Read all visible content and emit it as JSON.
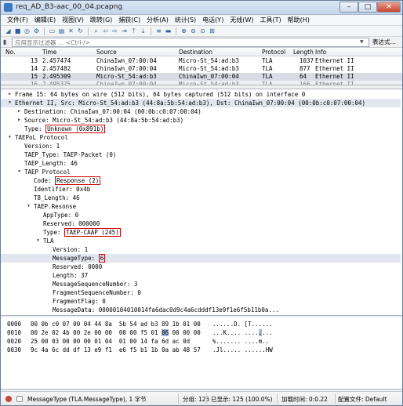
{
  "window": {
    "title": "req_AD_B3-aac_00_04.pcapng",
    "min": "–",
    "max": "□",
    "close": "✕"
  },
  "menu": [
    "文件(F)",
    "编辑(E)",
    "视图(V)",
    "跳转(G)",
    "捕获(C)",
    "分析(A)",
    "统计(S)",
    "电话(Y)",
    "无线(W)",
    "工具(T)",
    "帮助(H)"
  ],
  "toolbar": {
    "icons": [
      {
        "name": "start-capture-icon",
        "glyph": "◢"
      },
      {
        "name": "stop-capture-icon",
        "glyph": "■"
      },
      {
        "name": "restart-capture-icon",
        "glyph": "◎"
      },
      {
        "name": "capture-options-icon",
        "glyph": "⚙"
      },
      {
        "name": "sep"
      },
      {
        "name": "open-file-icon",
        "glyph": "▭"
      },
      {
        "name": "save-file-icon",
        "glyph": "▤"
      },
      {
        "name": "close-file-icon",
        "glyph": "✕"
      },
      {
        "name": "reload-icon",
        "glyph": "↻"
      },
      {
        "name": "sep"
      },
      {
        "name": "find-packet-icon",
        "glyph": "⌕"
      },
      {
        "name": "go-back-icon",
        "glyph": "⇦"
      },
      {
        "name": "go-forward-icon",
        "glyph": "⇨"
      },
      {
        "name": "go-to-packet-icon",
        "glyph": "⇥"
      },
      {
        "name": "first-packet-icon",
        "glyph": "⤒"
      },
      {
        "name": "last-packet-icon",
        "glyph": "⤓"
      },
      {
        "name": "sep"
      },
      {
        "name": "autoscroll-icon",
        "glyph": "≡"
      },
      {
        "name": "colorize-icon",
        "glyph": "▬"
      },
      {
        "name": "sep"
      },
      {
        "name": "zoom-in-icon",
        "glyph": "⊕"
      },
      {
        "name": "zoom-out-icon",
        "glyph": "⊖"
      },
      {
        "name": "zoom-reset-icon",
        "glyph": "⊙"
      },
      {
        "name": "resize-columns-icon",
        "glyph": "⊞"
      }
    ]
  },
  "filter": {
    "placeholder": "应用显示过滤器 … <Ctrl-/>",
    "expression_label": "表达式…",
    "plus": "+"
  },
  "packet_list": {
    "columns": [
      "No.",
      "Time",
      "Source",
      "Destination",
      "Protocol",
      "Length",
      "Info"
    ],
    "rows": [
      {
        "no": "13",
        "time": "2.457474",
        "src": "ChinaIwn_07:00:04",
        "dst": "Micro-St_54:ad:b3",
        "proto": "TLA",
        "len": "1037",
        "info": "Ethernet II",
        "style": "normal"
      },
      {
        "no": "14",
        "time": "2.457482",
        "src": "ChinaIwn_07:00:04",
        "dst": "Micro-St_54:ad:b3",
        "proto": "TLA",
        "len": "877",
        "info": "Ethernet II",
        "style": "normal"
      },
      {
        "no": "15",
        "time": "2.495309",
        "src": "Micro-St_54:ad:b3",
        "dst": "ChinaIwn_07:00:04",
        "proto": "TLA",
        "len": "64",
        "info": "Ethernet II",
        "style": "selected"
      },
      {
        "no": "16",
        "time": "2.495375",
        "src": "ChinaIwn_07:00:04",
        "dst": "Micro-St_54:ad:b3",
        "proto": "TLA",
        "len": "166",
        "info": "Ethernet II",
        "style": "dim"
      }
    ]
  },
  "details": [
    {
      "text": "Frame 15: 64 bytes on wire (512 bits), 64 bytes captured (512 bits) on interface 0",
      "indent": 0,
      "arrow": "▶"
    },
    {
      "text": "Ethernet II, Src: Micro-St_54:ad:b3 (44:8a:5b:54:ad:b3), Dst: ChinaIwn_07:00:04 (00:0b:c0:07:00:04)",
      "indent": 0,
      "arrow": "▼",
      "selected": true
    },
    {
      "text": "Destination: ChinaIwn_07:00:04 (00:0b:c0:07:00:04)",
      "indent": 1,
      "arrow": "▶"
    },
    {
      "text": "Source: Micro-St_54:ad:b3 (44:8a:5b:54:ad:b3)",
      "indent": 1,
      "arrow": "▶"
    },
    {
      "label": "Type: ",
      "boxed": "Unknown (0x891b)",
      "indent": 1
    },
    {
      "text": "TAEPoL Protocol",
      "indent": 0,
      "arrow": "▼"
    },
    {
      "text": "Version: 1",
      "indent": 1
    },
    {
      "text": "TAEP_Type: TAEP-Packet (0)",
      "indent": 1
    },
    {
      "text": "TAEP_Length: 46",
      "indent": 1
    },
    {
      "text": "TAEP Protocol",
      "indent": 1,
      "arrow": "▼"
    },
    {
      "label": "Code: ",
      "boxed": "Response (2)",
      "indent": 2
    },
    {
      "text": "Identifier: 0x4b",
      "indent": 2
    },
    {
      "text": "T8_Length: 46",
      "indent": 2
    },
    {
      "text": "TAEP.Resonse",
      "indent": 2,
      "arrow": "▼"
    },
    {
      "text": "AppType: 0",
      "indent": 3
    },
    {
      "text": "Reserved: 000000",
      "indent": 3
    },
    {
      "label": "Type: ",
      "boxed": "TAEP-CAAP (245)",
      "indent": 3
    },
    {
      "text": "TLA",
      "indent": 3,
      "arrow": "▼"
    },
    {
      "text": "Version: 1",
      "indent": 4
    },
    {
      "label": "MessageType: ",
      "boxed": "6",
      "indent": 4,
      "selected": true
    },
    {
      "text": "Reserved: 0000",
      "indent": 4
    },
    {
      "text": "Length: 37",
      "indent": 4
    },
    {
      "text": "MessageSequenceNumber: 3",
      "indent": 4
    },
    {
      "text": "FragmentSequenceNumber: 0",
      "indent": 4
    },
    {
      "text": "FragmentFlag: 0",
      "indent": 4
    },
    {
      "text": "MessageData: 00000104010014fa6dac0d9c4a6cdddf13e9f1e6f5b11b0a...",
      "indent": 4
    }
  ],
  "bytes": [
    {
      "off": "0000",
      "hex_pre": "00 0b c0 07 00 04 44 8a  5b 54 ad b3 89 1b 01 00",
      "hl": "",
      "hex_post": "",
      "ascii_pre": "......D. [T......",
      "ascii_hl": "",
      "ascii_post": ""
    },
    {
      "off": "0010",
      "hex_pre": "00 2e 02 4b 00 2e 00 00  00 00 f5 01 ",
      "hl": "06",
      "hex_post": " 00 00 00",
      "ascii_pre": "...K.... ....",
      "ascii_hl": ".",
      "ascii_post": "..."
    },
    {
      "off": "0020",
      "hex_pre": "25 00 03 00 00 00 01 04  01 00 14 fa 6d ac 0d",
      "hl": "",
      "hex_post": "",
      "ascii_pre": "%....... ....m..",
      "ascii_hl": "",
      "ascii_post": ""
    },
    {
      "off": "0030",
      "hex_pre": "9c 4a 6c dd df 13 e9 f1  e6 f5 b1 1b 0a ab 48 57",
      "hl": "",
      "hex_post": "",
      "ascii_pre": ".Jl..... ......HW",
      "ascii_hl": "",
      "ascii_post": ""
    }
  ],
  "status": {
    "field": "MessageType (TLA.MessageType), 1 字节",
    "packets": "分组: 125",
    "displayed": "已显示: 125 (100.0%)",
    "load_time": "加载时间: 0:0.22",
    "profile": "配置文件: Default"
  }
}
